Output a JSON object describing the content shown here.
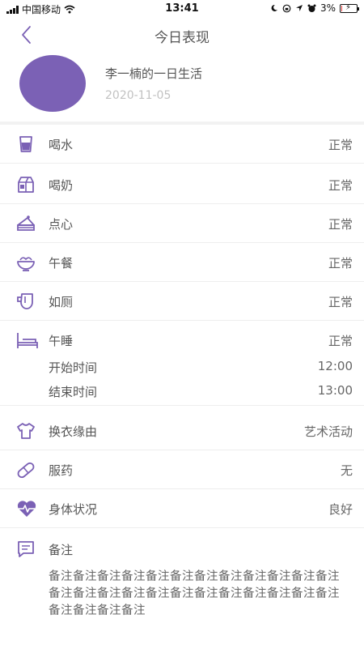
{
  "status_bar": {
    "carrier": "中国移动",
    "time": "13:41",
    "battery": "3%",
    "battery_level": 0.03
  },
  "nav": {
    "title": "今日表现"
  },
  "profile": {
    "name": "李一楠的一日生活",
    "date": "2020-11-05",
    "avatar_color": "#7b61b5"
  },
  "accent_color": "#7b61b5",
  "items": [
    {
      "icon": "cup-icon",
      "label": "喝水",
      "value": "正常"
    },
    {
      "icon": "milk-carton-icon",
      "label": "喝奶",
      "value": "正常"
    },
    {
      "icon": "cake-icon",
      "label": "点心",
      "value": "正常"
    },
    {
      "icon": "bowl-icon",
      "label": "午餐",
      "value": "正常"
    },
    {
      "icon": "toilet-icon",
      "label": "如厕",
      "value": "正常"
    },
    {
      "icon": "bed-icon",
      "label": "午睡",
      "value": "正常"
    }
  ],
  "nap": {
    "start_label": "开始时间",
    "start_value": "12:00",
    "end_label": "结束时间",
    "end_value": "13:00"
  },
  "items2": [
    {
      "icon": "shirt-icon",
      "label": "换衣缘由",
      "value": "艺术活动"
    },
    {
      "icon": "pill-icon",
      "label": "服药",
      "value": "无"
    },
    {
      "icon": "heart-pulse-icon",
      "label": "身体状况",
      "value": "良好"
    }
  ],
  "note": {
    "icon": "note-icon",
    "label": "备注",
    "text": "备注备注备注备注备注备注备注备注备注备注备注备注备注备注备注备注备注备注备注备注备注备注备注备注备注备注备注备注"
  }
}
